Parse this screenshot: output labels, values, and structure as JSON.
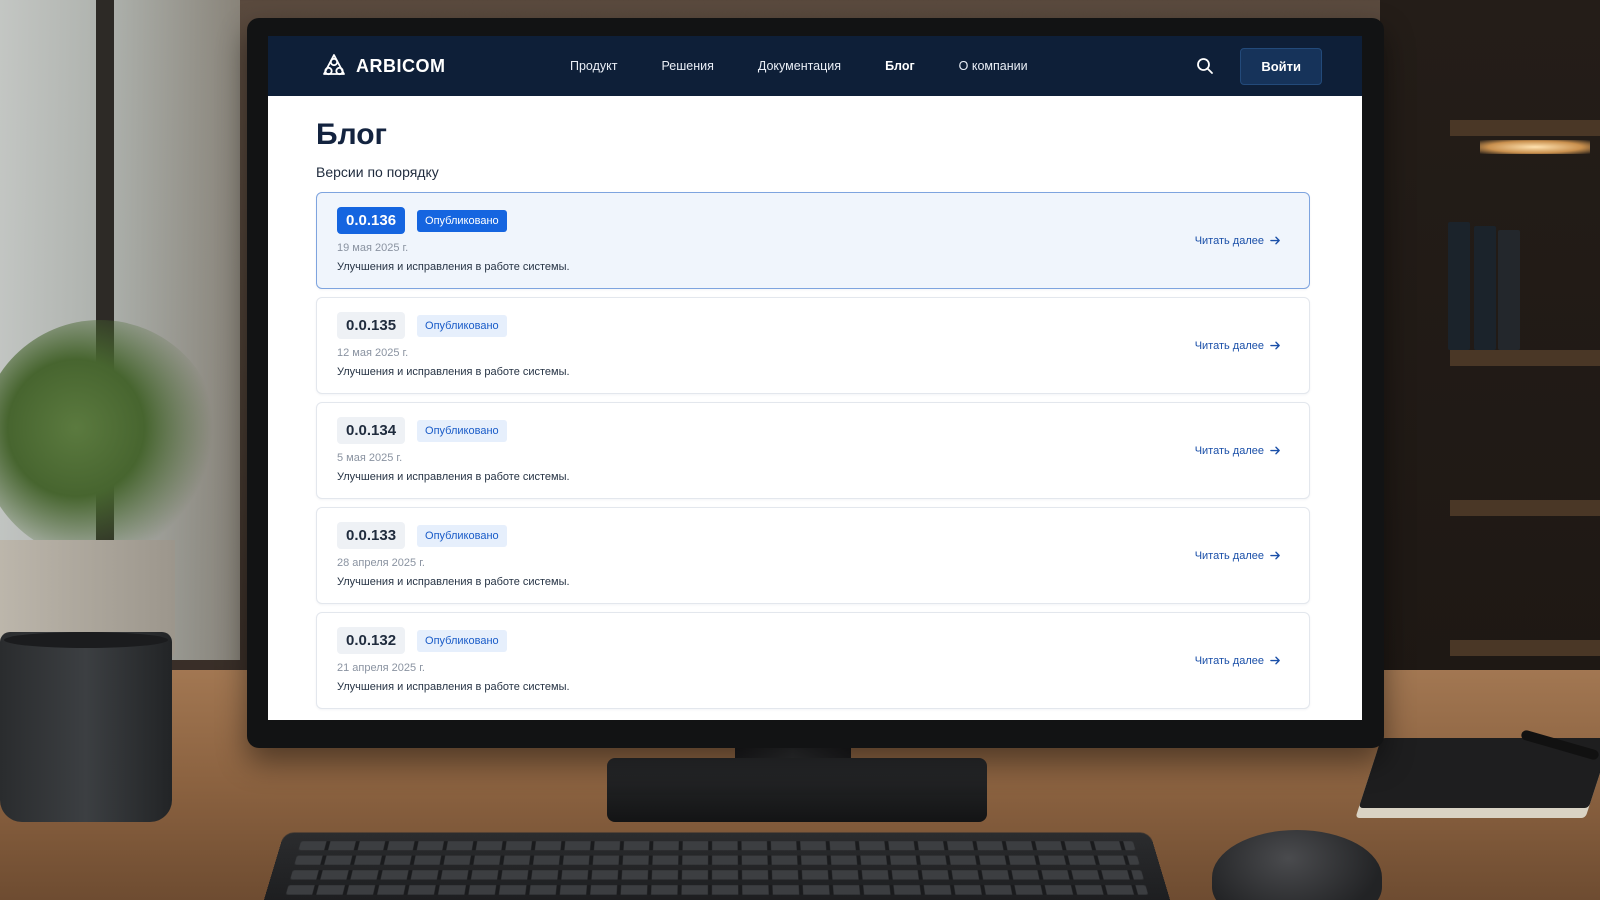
{
  "site": {
    "brand": "ARBICOM",
    "nav": [
      {
        "label": "Продукт",
        "active": false
      },
      {
        "label": "Решения",
        "active": false
      },
      {
        "label": "Документация",
        "active": false
      },
      {
        "label": "Блог",
        "active": true
      },
      {
        "label": "О компании",
        "active": false
      }
    ],
    "login_label": "Войти",
    "search_icon": "search-icon"
  },
  "page": {
    "title": "Блог",
    "subtitle": "Версии по порядку"
  },
  "releases": [
    {
      "version": "0.0.136",
      "status": "Опубликовано",
      "date": "19 мая 2025 г.",
      "description": "Улучшения и исправления в работе системы.",
      "read_more": "Читать далее",
      "selected": true
    },
    {
      "version": "0.0.135",
      "status": "Опубликовано",
      "date": "12 мая 2025 г.",
      "description": "Улучшения и исправления в работе системы.",
      "read_more": "Читать далее",
      "selected": false
    },
    {
      "version": "0.0.134",
      "status": "Опубликовано",
      "date": "5 мая 2025 г.",
      "description": "Улучшения и исправления в работе системы.",
      "read_more": "Читать далее",
      "selected": false
    },
    {
      "version": "0.0.133",
      "status": "Опубликовано",
      "date": "28 апреля 2025 г.",
      "description": "Улучшения и исправления в работе системы.",
      "read_more": "Читать далее",
      "selected": false
    },
    {
      "version": "0.0.132",
      "status": "Опубликовано",
      "date": "21 апреля 2025 г.",
      "description": "Улучшения и исправления в работе системы.",
      "read_more": "Читать далее",
      "selected": false
    }
  ],
  "colors": {
    "header_bg": "#0e1f38",
    "accent": "#1565e0",
    "selected_card_bg": "#f0f5fc"
  }
}
